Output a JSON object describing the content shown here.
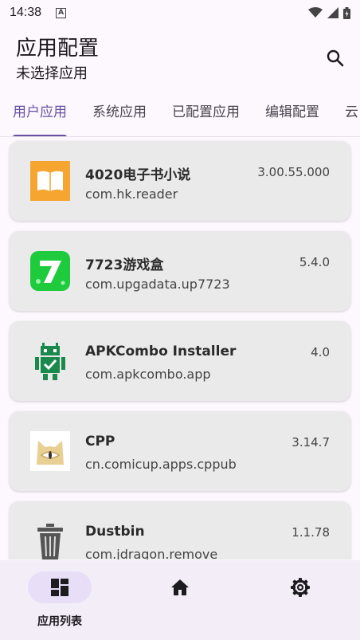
{
  "status": {
    "time": "14:38",
    "notification_icon": "A"
  },
  "header": {
    "title": "应用配置",
    "subtitle": "未选择应用"
  },
  "tabs": [
    {
      "label": "用户应用",
      "active": true
    },
    {
      "label": "系统应用"
    },
    {
      "label": "已配置应用"
    },
    {
      "label": "编辑配置"
    },
    {
      "label": "云"
    }
  ],
  "apps": [
    {
      "name": "4020电子书小说",
      "package": "com.hk.reader",
      "version": "3.00.55.000",
      "icon": "book-icon"
    },
    {
      "name": "7723游戏盒",
      "package": "com.upgadata.up7723",
      "version": "5.4.0",
      "icon": "7723-icon"
    },
    {
      "name": "APKCombo Installer",
      "package": "com.apkcombo.app",
      "version": "4.0",
      "icon": "android-robot-icon"
    },
    {
      "name": "CPP",
      "package": "cn.comicup.apps.cppub",
      "version": "3.14.7",
      "icon": "cat-icon"
    },
    {
      "name": "Dustbin",
      "package": "com.jdragon.remove",
      "version": "1.1.78",
      "icon": "trash-can-icon"
    }
  ],
  "bottom_nav": {
    "app_list_label": "应用列表"
  },
  "colors": {
    "accent": "#6750a4",
    "card": "#eaeaea",
    "nav_bg": "#f3edf7",
    "pill": "#e8def8"
  }
}
